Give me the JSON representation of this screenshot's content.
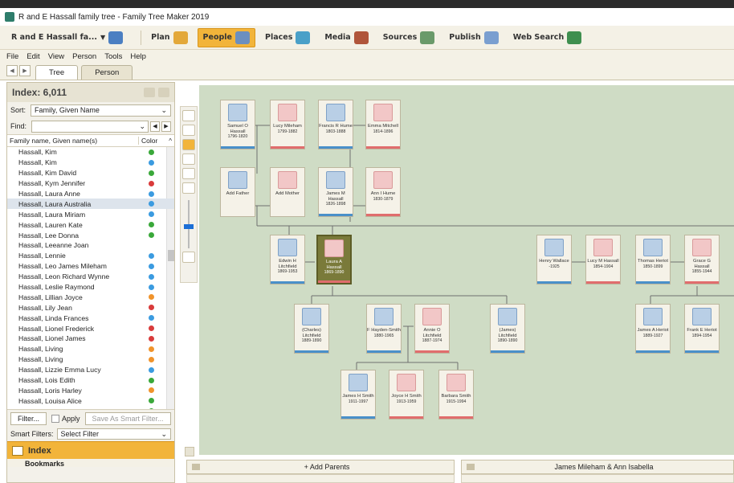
{
  "window": {
    "title": "R and E Hassall family tree - Family Tree Maker 2019"
  },
  "nav": {
    "tree_name": "R and E Hassall fa...",
    "items": [
      {
        "label": "Plan",
        "icon": "plan-icon",
        "active": false
      },
      {
        "label": "People",
        "icon": "people-icon",
        "active": true
      },
      {
        "label": "Places",
        "icon": "places-icon",
        "active": false
      },
      {
        "label": "Media",
        "icon": "media-icon",
        "active": false
      },
      {
        "label": "Sources",
        "icon": "sources-icon",
        "active": false
      },
      {
        "label": "Publish",
        "icon": "publish-icon",
        "active": false
      },
      {
        "label": "Web Search",
        "icon": "web-search-icon",
        "active": false
      }
    ]
  },
  "menu": [
    "File",
    "Edit",
    "View",
    "Person",
    "Tools",
    "Help"
  ],
  "tabs": [
    {
      "label": "Tree",
      "active": true
    },
    {
      "label": "Person",
      "active": false
    }
  ],
  "index": {
    "title": "Index: 6,011",
    "sort_label": "Sort:",
    "sort_value": "Family, Given Name",
    "find_label": "Find:",
    "col_name": "Family name, Given name(s)",
    "col_color": "Color",
    "names": [
      {
        "name": "Hassall, Kim",
        "color": "#3aa83a"
      },
      {
        "name": "Hassall, Kim",
        "color": "#3b9be0"
      },
      {
        "name": "Hassall, Kim David",
        "color": "#3aa83a"
      },
      {
        "name": "Hassall, Kym Jennifer",
        "color": "#d93b3b"
      },
      {
        "name": "Hassall, Laura Anne",
        "color": "#3b9be0"
      },
      {
        "name": "Hassall, Laura Australia",
        "color": "#3b9be0",
        "selected": true
      },
      {
        "name": "Hassall, Laura Miriam",
        "color": "#3b9be0"
      },
      {
        "name": "Hassall, Lauren Kate",
        "color": "#3aa83a"
      },
      {
        "name": "Hassall, Lee Donna",
        "color": "#3aa83a"
      },
      {
        "name": "Hassall, Leeanne Joan",
        "color": ""
      },
      {
        "name": "Hassall, Lennie",
        "color": "#3b9be0"
      },
      {
        "name": "Hassall, Leo James Mileham",
        "color": "#3b9be0"
      },
      {
        "name": "Hassall, Leon Richard Wynne",
        "color": "#3b9be0"
      },
      {
        "name": "Hassall, Leslie Raymond",
        "color": "#3b9be0"
      },
      {
        "name": "Hassall, Lillian Joyce",
        "color": "#f0932b"
      },
      {
        "name": "Hassall, Lily Jean",
        "color": "#d93b3b"
      },
      {
        "name": "Hassall, Linda Frances",
        "color": "#3b9be0"
      },
      {
        "name": "Hassall, Lionel Frederick",
        "color": "#d93b3b"
      },
      {
        "name": "Hassall, Lionel James",
        "color": "#d93b3b"
      },
      {
        "name": "Hassall, Living",
        "color": "#f0932b"
      },
      {
        "name": "Hassall, Living",
        "color": "#f0932b"
      },
      {
        "name": "Hassall, Lizzie Emma Lucy",
        "color": "#3b9be0"
      },
      {
        "name": "Hassall, Lois Edith",
        "color": "#3aa83a"
      },
      {
        "name": "Hassall, Loris Harley",
        "color": "#f0932b"
      },
      {
        "name": "Hassall, Louisa Alice",
        "color": "#3aa83a"
      },
      {
        "name": "Hassall, Louisa Elizabeth",
        "color": "#3aa83a"
      }
    ],
    "filter_button": "Filter...",
    "apply_label": "Apply",
    "save_smart_filter": "Save As Smart Filter...",
    "smart_filters_label": "Smart Filters:",
    "smart_filters_value": "Select Filter",
    "index_bar": "Index",
    "bookmarks_bar": "Bookmarks"
  },
  "tree": {
    "people": [
      {
        "name": "Samuel O Hassall",
        "years": "1796-1820",
        "sex": "m"
      },
      {
        "name": "Lucy Mileham",
        "years": "1799-1882",
        "sex": "f"
      },
      {
        "name": "Francis R Hume",
        "years": "1803-1888",
        "sex": "m"
      },
      {
        "name": "Emma Mitchell",
        "years": "1814-1896",
        "sex": "f"
      },
      {
        "name": "Add Father",
        "years": "",
        "sex": "m",
        "placeholder": true
      },
      {
        "name": "Add Mother",
        "years": "",
        "sex": "f",
        "placeholder": true
      },
      {
        "name": "James M Hassall",
        "years": "1826-1898",
        "sex": "m"
      },
      {
        "name": "Ann I Hume",
        "years": "1830-1879",
        "sex": "f"
      },
      {
        "name": "Edwin H Litchfield",
        "years": "1869-1953",
        "sex": "m"
      },
      {
        "name": "Laura A Hassall",
        "years": "1869-1890",
        "sex": "f",
        "focus": true
      },
      {
        "name": "Henry Wallace",
        "years": "-1925",
        "sex": "m"
      },
      {
        "name": "Lucy M Hassall",
        "years": "1854-1904",
        "sex": "f"
      },
      {
        "name": "Thomas Heriot",
        "years": "1850-1899",
        "sex": "m"
      },
      {
        "name": "Grace G Hassall",
        "years": "1855-1944",
        "sex": "f"
      },
      {
        "name": "(Charles) Litchfield",
        "years": "1889-1890",
        "sex": "m"
      },
      {
        "name": "F Hayden-Smith",
        "years": "1880-1965",
        "sex": "m"
      },
      {
        "name": "Annie O Litchfield",
        "years": "1887-1974",
        "sex": "f"
      },
      {
        "name": "(James) Litchfield",
        "years": "1890-1890",
        "sex": "m"
      },
      {
        "name": "James A Heriot",
        "years": "1889-1927",
        "sex": "m"
      },
      {
        "name": "Frank E Heriot",
        "years": "1894-1954",
        "sex": "m"
      },
      {
        "name": "James H Smith",
        "years": "1911-1997",
        "sex": "m"
      },
      {
        "name": "Joyce H Smith",
        "years": "1913-1959",
        "sex": "f"
      },
      {
        "name": "Barbara Smith",
        "years": "1915-1994",
        "sex": "f"
      }
    ]
  },
  "bottom": {
    "add_parents": "+ Add Parents",
    "family_label": "James Mileham & Ann Isabella"
  }
}
